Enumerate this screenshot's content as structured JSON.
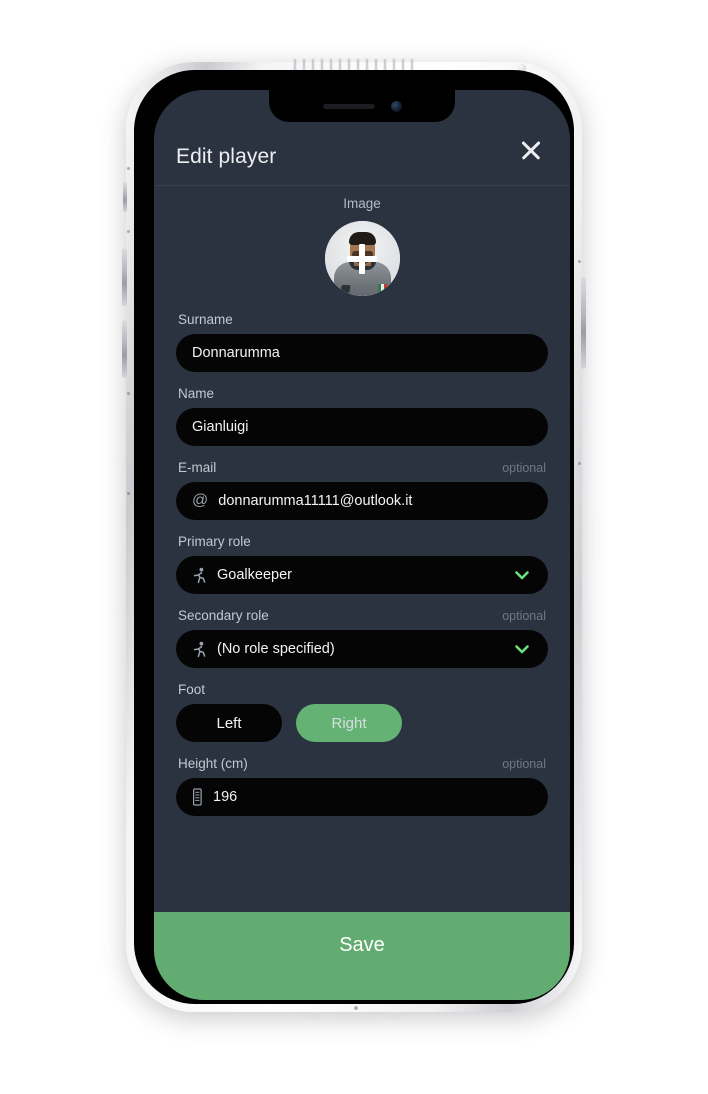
{
  "header": {
    "title": "Edit player",
    "close_icon": "close-icon"
  },
  "form": {
    "image_label": "Image",
    "avatar_icon": "player-photo-avatar",
    "add_photo_icon": "plus-icon",
    "surname": {
      "label": "Surname",
      "value": "Donnarumma",
      "placeholder": "Surname"
    },
    "name": {
      "label": "Name",
      "value": "Gianluigi",
      "placeholder": "Name"
    },
    "email": {
      "label": "E-mail",
      "optional": "optional",
      "icon": "at-icon",
      "value": "donnarumma11111@outlook.it",
      "placeholder": "E-mail"
    },
    "primary_role": {
      "label": "Primary role",
      "icon": "running-person-icon",
      "value": "Goalkeeper",
      "chevron_icon": "chevron-down-icon"
    },
    "secondary_role": {
      "label": "Secondary role",
      "optional": "optional",
      "icon": "running-person-icon",
      "value": "(No role specified)",
      "chevron_icon": "chevron-down-icon"
    },
    "foot": {
      "label": "Foot",
      "left_label": "Left",
      "right_label": "Right",
      "selected": "Right"
    },
    "height": {
      "label": "Height (cm)",
      "optional": "optional",
      "icon": "ruler-icon",
      "value": "196",
      "placeholder": "Height (cm)"
    }
  },
  "save": {
    "label": "Save"
  },
  "colors": {
    "screen_bg": "#2b3240",
    "field_bg": "#050505",
    "accent_green": "#62ab71",
    "toggle_green": "#64b374",
    "chevron_green": "#6ee07a",
    "label_text": "#c3c9d2",
    "optional_text": "#6f7886"
  }
}
